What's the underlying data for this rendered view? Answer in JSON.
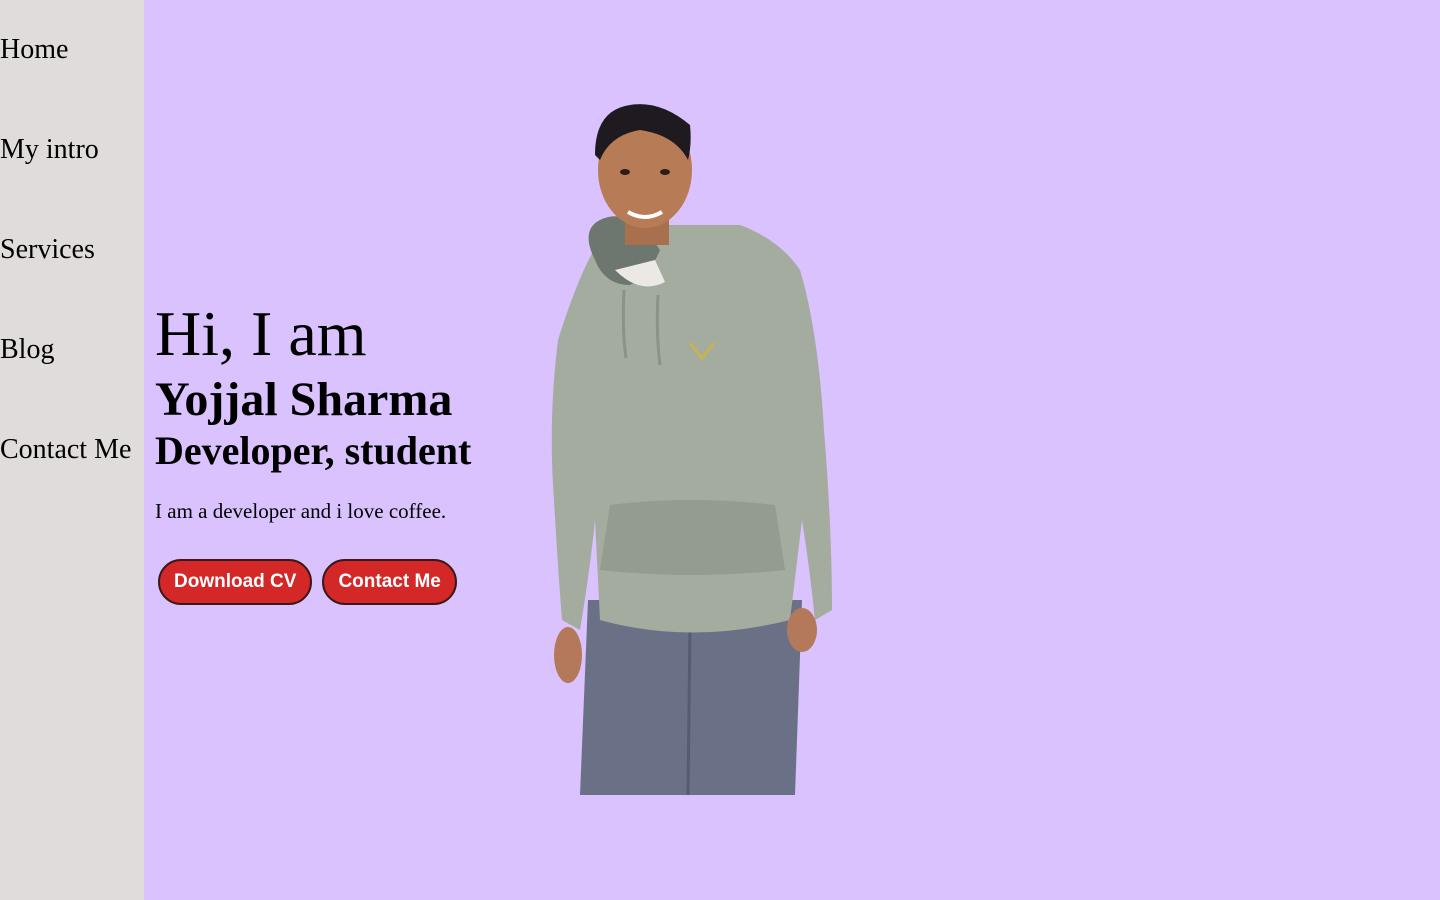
{
  "nav": {
    "items": [
      {
        "label": "Home"
      },
      {
        "label": "My intro"
      },
      {
        "label": "Services"
      },
      {
        "label": "Blog"
      },
      {
        "label": "Contact Me"
      }
    ]
  },
  "hero": {
    "greeting": "Hi, I am",
    "name": "Yojjal Sharma",
    "role": "Developer, student",
    "bio": "I am a developer and i love coffee."
  },
  "actions": {
    "download_label": "Download CV",
    "contact_label": "Contact Me"
  },
  "colors": {
    "page_background": "#d9c2fd",
    "sidebar_background": "#e0dcdb",
    "button_background": "#d42727",
    "button_text": "#ffffff"
  }
}
